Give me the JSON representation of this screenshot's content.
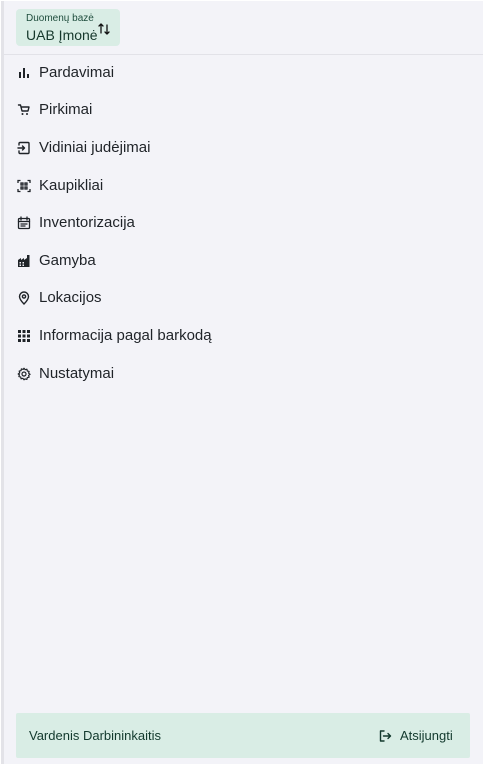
{
  "database": {
    "label": "Duomenų bazė",
    "name": "UAB Įmonė",
    "swap_icon": "swap-vertical-icon"
  },
  "sidebar": {
    "items": [
      {
        "label": "Pardavimai",
        "icon": "bar-chart-icon"
      },
      {
        "label": "Pirkimai",
        "icon": "shopping-cart-icon"
      },
      {
        "label": "Vidiniai judėjimai",
        "icon": "internal-transfer-icon"
      },
      {
        "label": "Kaupikliai",
        "icon": "collector-icon"
      },
      {
        "label": "Inventorizacija",
        "icon": "calendar-icon"
      },
      {
        "label": "Gamyba",
        "icon": "factory-icon"
      },
      {
        "label": "Lokacijos",
        "icon": "location-pin-icon"
      },
      {
        "label": "Informacija pagal barkodą",
        "icon": "grid-dots-icon"
      },
      {
        "label": "Nustatymai",
        "icon": "gear-icon"
      }
    ]
  },
  "user": {
    "name": "Vardenis Darbininkaitis",
    "logout_label": "Atsijungti",
    "logout_icon": "logout-icon"
  },
  "colors": {
    "accent_bg": "#d9ede5",
    "sidebar_bg": "#f3f3f8",
    "text": "#1f2328"
  }
}
